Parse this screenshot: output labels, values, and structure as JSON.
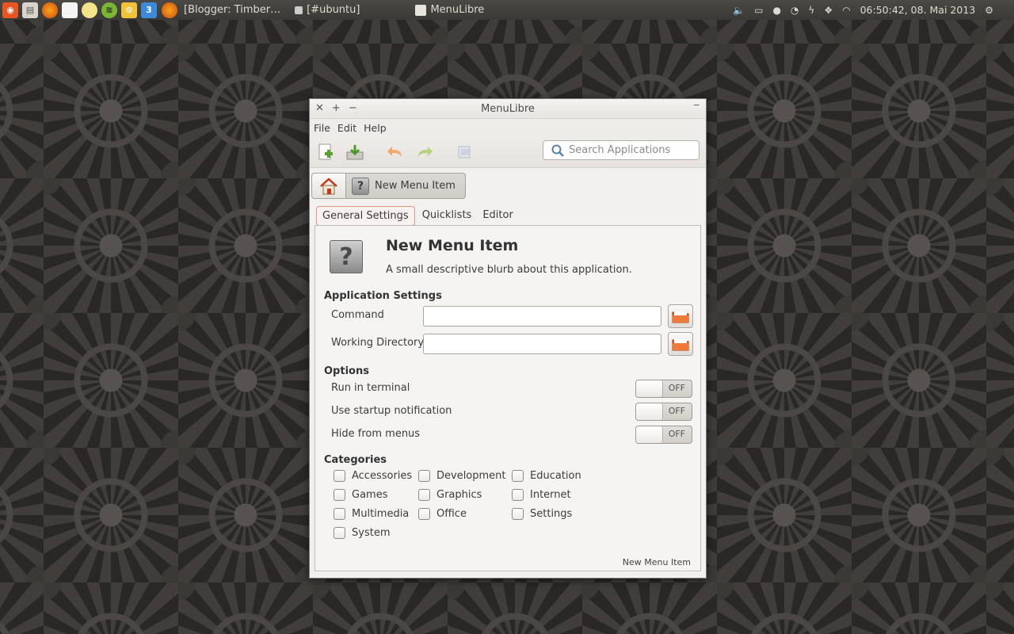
{
  "panel": {
    "tasks": [
      {
        "label": "[Blogger: Timber…",
        "color": "#e66000"
      },
      {
        "label": "[#ubuntu]",
        "color": "#cccccc"
      },
      {
        "label": "MenuLibre",
        "color": "#e8e4dc"
      }
    ],
    "badge_count": "3",
    "clock": "06:50:42, 08. Mai 2013"
  },
  "window": {
    "title": "MenuLibre",
    "menu": [
      "File",
      "Edit",
      "Help"
    ],
    "search_placeholder": "Search Applications",
    "breadcrumb_item": "New Menu Item",
    "tabs": [
      "General Settings",
      "Quicklists",
      "Editor"
    ],
    "app": {
      "name": "New Menu Item",
      "description": "A small descriptive blurb about this application."
    },
    "app_settings": {
      "heading": "Application Settings",
      "command_label": "Command",
      "command_value": "",
      "workdir_label": "Working Directory",
      "workdir_value": ""
    },
    "options": {
      "heading": "Options",
      "items": [
        {
          "label": "Run in terminal",
          "state": "OFF"
        },
        {
          "label": "Use startup notification",
          "state": "OFF"
        },
        {
          "label": "Hide from menus",
          "state": "OFF"
        }
      ]
    },
    "categories": {
      "heading": "Categories",
      "items": [
        "Accessories",
        "Development",
        "Education",
        "Games",
        "Graphics",
        "Internet",
        "Multimedia",
        "Office",
        "Settings",
        "System"
      ]
    },
    "status": "New Menu Item"
  },
  "colors": {
    "ubuntu_orange": "#e95420",
    "panel": "#3c3b37"
  }
}
